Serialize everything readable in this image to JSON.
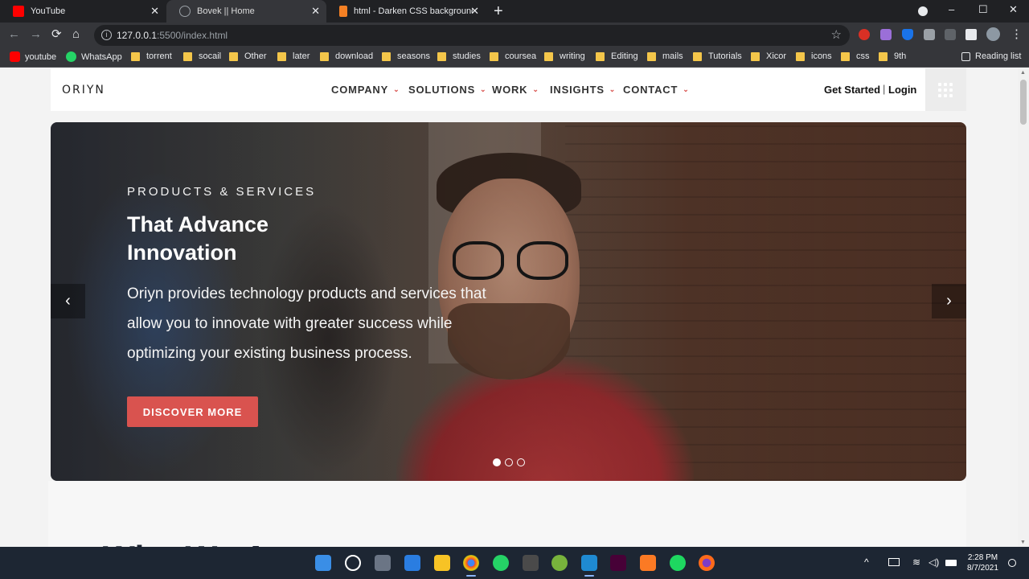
{
  "browser": {
    "tabs": [
      {
        "title": "YouTube",
        "icon": "youtube-icon"
      },
      {
        "title": "Bovek || Home",
        "icon": "globe-icon"
      },
      {
        "title": "html - Darken CSS background i",
        "icon": "stackoverflow-icon"
      }
    ],
    "new_tab": "+",
    "window_controls": [
      "–",
      "☐",
      "✕"
    ],
    "nav": {
      "back": "←",
      "forward": "→",
      "reload": "⟳",
      "home": "⌂"
    },
    "url_host": "127.0.0.1",
    "url_rest": ":5500/index.html",
    "bookmarks": [
      {
        "label": "youtube",
        "type": "youtube"
      },
      {
        "label": "WhatsApp",
        "type": "whatsapp"
      },
      {
        "label": "torrent",
        "type": "folder"
      },
      {
        "label": "socail",
        "type": "folder"
      },
      {
        "label": "Other",
        "type": "folder"
      },
      {
        "label": "later",
        "type": "folder"
      },
      {
        "label": "download",
        "type": "folder"
      },
      {
        "label": "seasons",
        "type": "folder"
      },
      {
        "label": "studies",
        "type": "folder"
      },
      {
        "label": "coursea",
        "type": "folder"
      },
      {
        "label": "writing",
        "type": "folder"
      },
      {
        "label": "Editing",
        "type": "folder"
      },
      {
        "label": "mails",
        "type": "folder"
      },
      {
        "label": "Tutorials",
        "type": "folder"
      },
      {
        "label": "Xicor",
        "type": "folder"
      },
      {
        "label": "icons",
        "type": "folder"
      },
      {
        "label": "css",
        "type": "folder"
      },
      {
        "label": "9th",
        "type": "folder"
      }
    ],
    "reading_list": "Reading list"
  },
  "site": {
    "logo": "ORIYN",
    "nav": [
      "COMPANY",
      "SOLUTIONS",
      "WORK",
      "INSIGHTS",
      "CONTACT"
    ],
    "get_started": "Get Started",
    "separator": "|",
    "login": "Login"
  },
  "hero": {
    "eyebrow": "PRODUCTS & SERVICES",
    "headline": "That Advance Innovation",
    "lead": "Oriyn provides technology products and services that allow you to innovate with greater success while optimizing your existing business process.",
    "cta": "DISCOVER MORE",
    "prev": "‹",
    "next": "›",
    "slides": 3,
    "active_slide": 1
  },
  "section": {
    "title_partial": "Who We A"
  },
  "taskbar": {
    "time": "2:28 PM",
    "date": "8/7/2021"
  },
  "colors": {
    "accent": "#d9534f",
    "chrome_dark": "#202124",
    "taskbar": "#1d2633"
  }
}
